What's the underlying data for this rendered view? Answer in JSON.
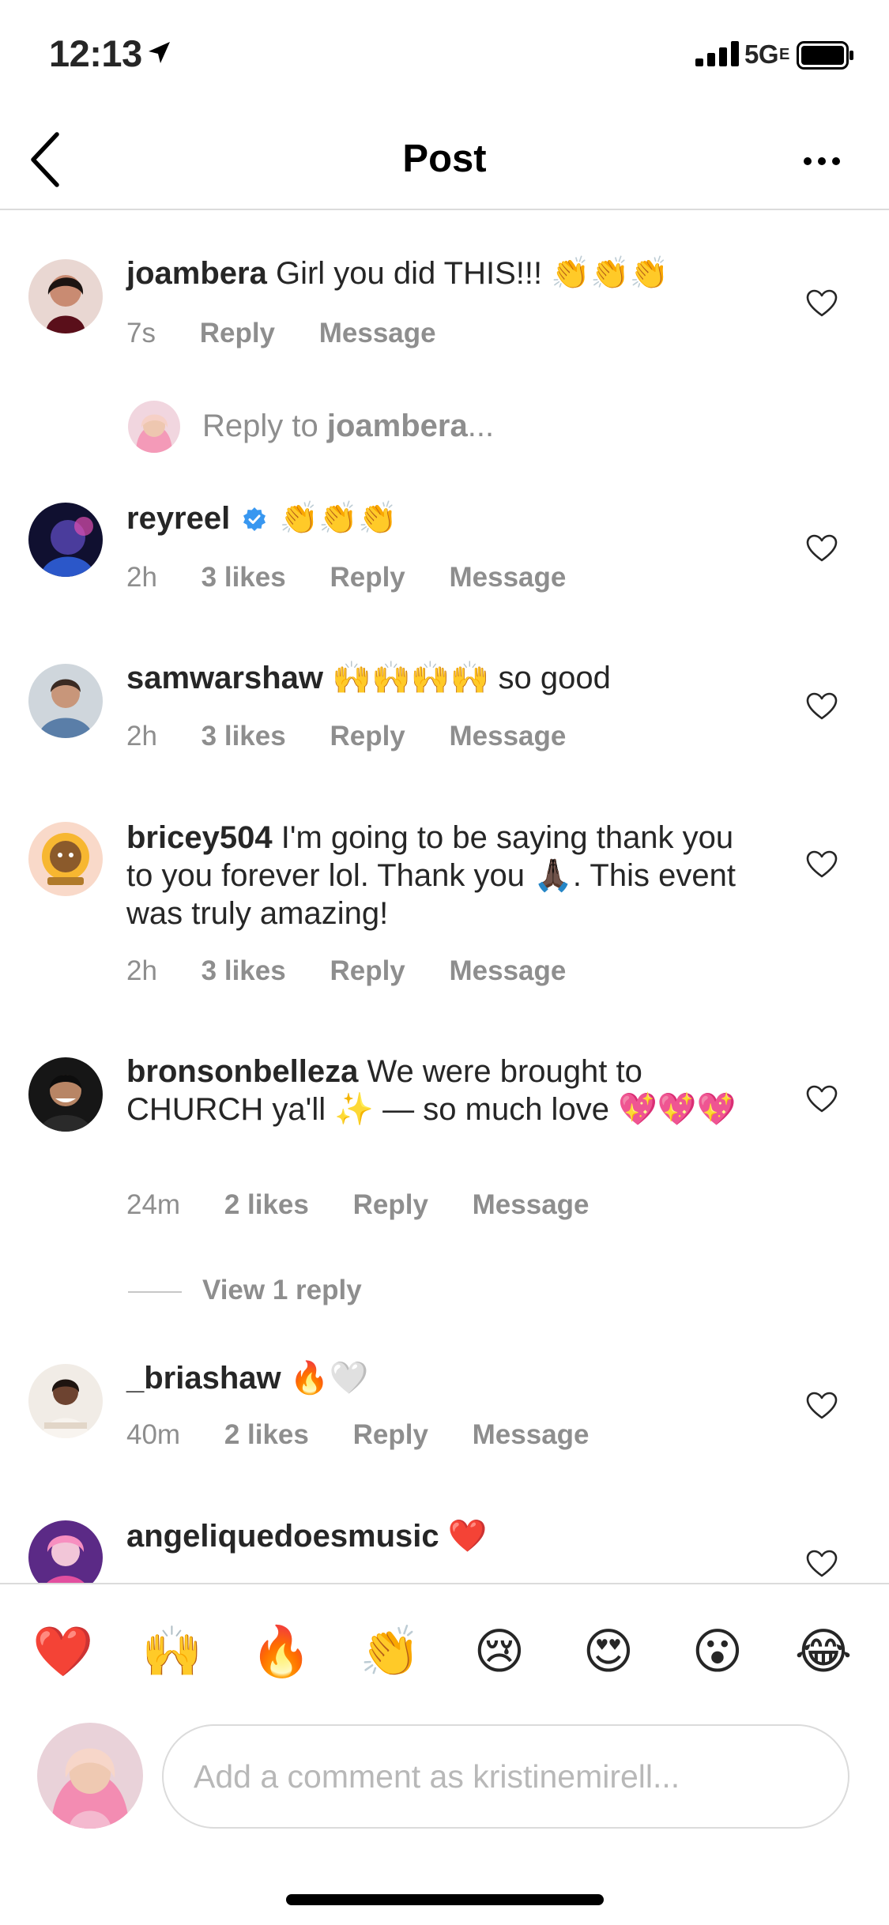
{
  "status": {
    "time": "12:13",
    "network": "5G",
    "network_sub": "E",
    "icons": [
      "location-arrow-icon",
      "signal-icon",
      "battery-icon"
    ]
  },
  "nav": {
    "title": "Post",
    "back_icon": "chevron-left-icon",
    "more_icon": "more-horizontal-icon"
  },
  "comments": [
    {
      "username": "joambera",
      "text": "Girl you did THIS!!!",
      "emoji": "👏👏👏",
      "time": "7s",
      "likes": "",
      "reply": "Reply",
      "message": "Message"
    },
    {
      "username": "reyreel",
      "verified": true,
      "text": "",
      "emoji": "👏👏👏",
      "time": "2h",
      "likes": "3 likes",
      "reply": "Reply",
      "message": "Message"
    },
    {
      "username": "samwarshaw",
      "emoji": "🙌🙌🙌🙌",
      "text": "so good",
      "time": "2h",
      "likes": "3 likes",
      "reply": "Reply",
      "message": "Message"
    },
    {
      "username": "bricey504",
      "text": "I'm going to be saying thank you to you forever lol. Thank you",
      "emoji": "🙏🏿",
      "text2": ". This event was truly amazing!",
      "time": "2h",
      "likes": "3 likes",
      "reply": "Reply",
      "message": "Message"
    },
    {
      "username": "bronsonbelleza",
      "text": "We were brought to CHURCH ya'll",
      "emoji": "✨",
      "text2": "— so much love",
      "emoji2": "💖💖💖",
      "time": "24m",
      "likes": "2 likes",
      "reply": "Reply",
      "message": "Message"
    },
    {
      "username": "_briashaw",
      "emoji": "🔥🤍",
      "time": "40m",
      "likes": "2 likes",
      "reply": "Reply",
      "message": "Message"
    },
    {
      "username": "angeliquedoesmusic",
      "emoji": "❤️"
    }
  ],
  "reply_prompt": {
    "prefix": "Reply to",
    "username": "joambera",
    "suffix": "..."
  },
  "view_replies": "View 1 reply",
  "composer": {
    "quick_emojis": [
      "❤️",
      "🙌",
      "🔥",
      "👏",
      "😢",
      "😍",
      "😮",
      "😂"
    ],
    "placeholder": "Add a comment as kristinemirell..."
  },
  "colors": {
    "text": "#262626",
    "secondary": "#8e8e8e",
    "divider": "#dbdbdb",
    "verified": "#3897f0"
  }
}
